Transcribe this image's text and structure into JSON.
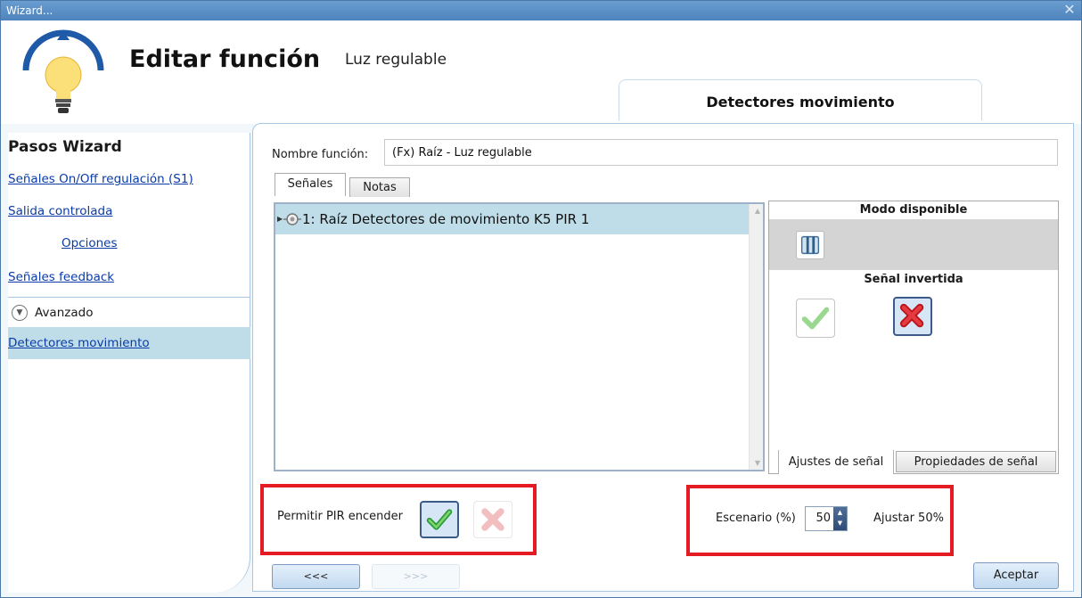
{
  "window": {
    "title": "Wizard...",
    "close_glyph": "✕"
  },
  "header": {
    "title": "Editar función",
    "subtitle": "Luz regulable",
    "active_step_tab": "Detectores movimiento"
  },
  "sidebar": {
    "title": "Pasos Wizard",
    "items": [
      {
        "label": "Señales On/Off regulación (S1)"
      },
      {
        "label": "Salida controlada"
      },
      {
        "label": "Opciones"
      },
      {
        "label": "Señales feedback"
      }
    ],
    "advanced_label": "Avanzado",
    "active_item": "Detectores movimiento"
  },
  "main": {
    "function_name_label": "Nombre función:",
    "function_name_value": "(Fx) Raíz - Luz regulable",
    "tabs": [
      "Señales",
      "Notas"
    ],
    "signals": [
      {
        "label": "1: Raíz Detectores de movimiento K5 PIR 1"
      }
    ],
    "right_panel": {
      "mode_header": "Modo disponible",
      "inverted_header": "Señal invertida",
      "tabs": [
        "Ajustes de señal",
        "Propiedades de señal"
      ]
    },
    "pir": {
      "label": "Permitir PIR encender"
    },
    "scenario": {
      "label": "Escenario (%)",
      "value": "50",
      "adjust_label": "Ajustar 50%"
    }
  },
  "footer": {
    "back_label": "<<<",
    "next_label": ">>>",
    "accept_label": "Aceptar"
  },
  "colors": {
    "titlebar": "#5a8fc6",
    "link": "#0a3ba8",
    "selection": "#bfdde9",
    "highlight_box": "#e51b23"
  },
  "icons": [
    "light-bulb-icon",
    "motion-sensor-icon",
    "mode-icon",
    "check-icon",
    "x-icon",
    "chevron-down-icon",
    "close-icon"
  ]
}
